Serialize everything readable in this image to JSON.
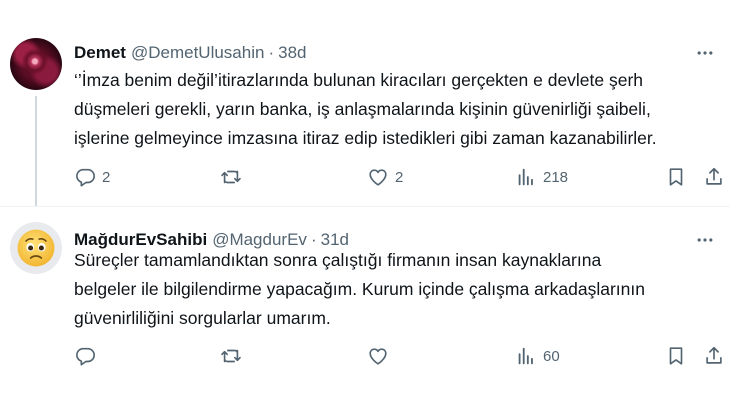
{
  "tweets": [
    {
      "display_name": "Demet",
      "handle": "@DemetUlusahin",
      "separator": "·",
      "time": "38d",
      "avatar": "rose-avatar",
      "lines": [
        "‘’İmza benim değil’itirazlarında bulunan kiracıları gerçekten e devlete şerh",
        "düşmeleri gerekli, yarın banka, iş anlaşmalarında kişinin güvenirliği şaibeli,",
        "işlerine gelmeyince imzasına itiraz edip istedikleri gibi zaman kazanabilirler."
      ],
      "replies": "2",
      "retweets": "",
      "likes": "2",
      "views": "218"
    },
    {
      "display_name": "MağdurEvSahibi",
      "handle": "@MagdurEv",
      "separator": "·",
      "time": "31d",
      "avatar": "worried-face-emoji",
      "lines": [
        "Süreçler tamamlandıktan sonra çalıştığı firmanın insan kaynaklarına",
        "belgeler ile bilgilendirme yapacağım. Kurum içinde çalışma arkadaşlarının",
        "güvenirliliğini sorgularlar umarım."
      ],
      "replies": "",
      "retweets": "",
      "likes": "",
      "views": "60"
    }
  ],
  "icons": {
    "reply": "reply-icon",
    "retweet": "retweet-icon",
    "like": "heart-icon",
    "views": "views-icon",
    "bookmark": "bookmark-icon",
    "share": "share-icon",
    "more": "more-icon"
  },
  "colors": {
    "text": "#0f1419",
    "secondary": "#536471",
    "divider": "#eff3f4",
    "thread_line": "#cfd9de"
  }
}
